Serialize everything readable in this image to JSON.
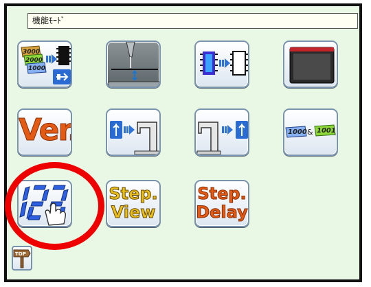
{
  "window": {
    "title": "機能ﾓｰﾄﾞ"
  },
  "buttons": {
    "card_to_usb": {
      "cards": [
        "3000",
        "2000",
        "1000"
      ]
    },
    "version": {
      "label": "Ver."
    },
    "card_compare": {
      "left": "1000",
      "amp": "&",
      "right": "1001",
      "more": "..."
    },
    "step_view": {
      "line1": "Step.",
      "line2": "View"
    },
    "step_delay": {
      "line1": "Step.",
      "line2": "Delay"
    },
    "top": {
      "label": "TOP"
    }
  },
  "annotation": {
    "color": "#ee0000"
  }
}
